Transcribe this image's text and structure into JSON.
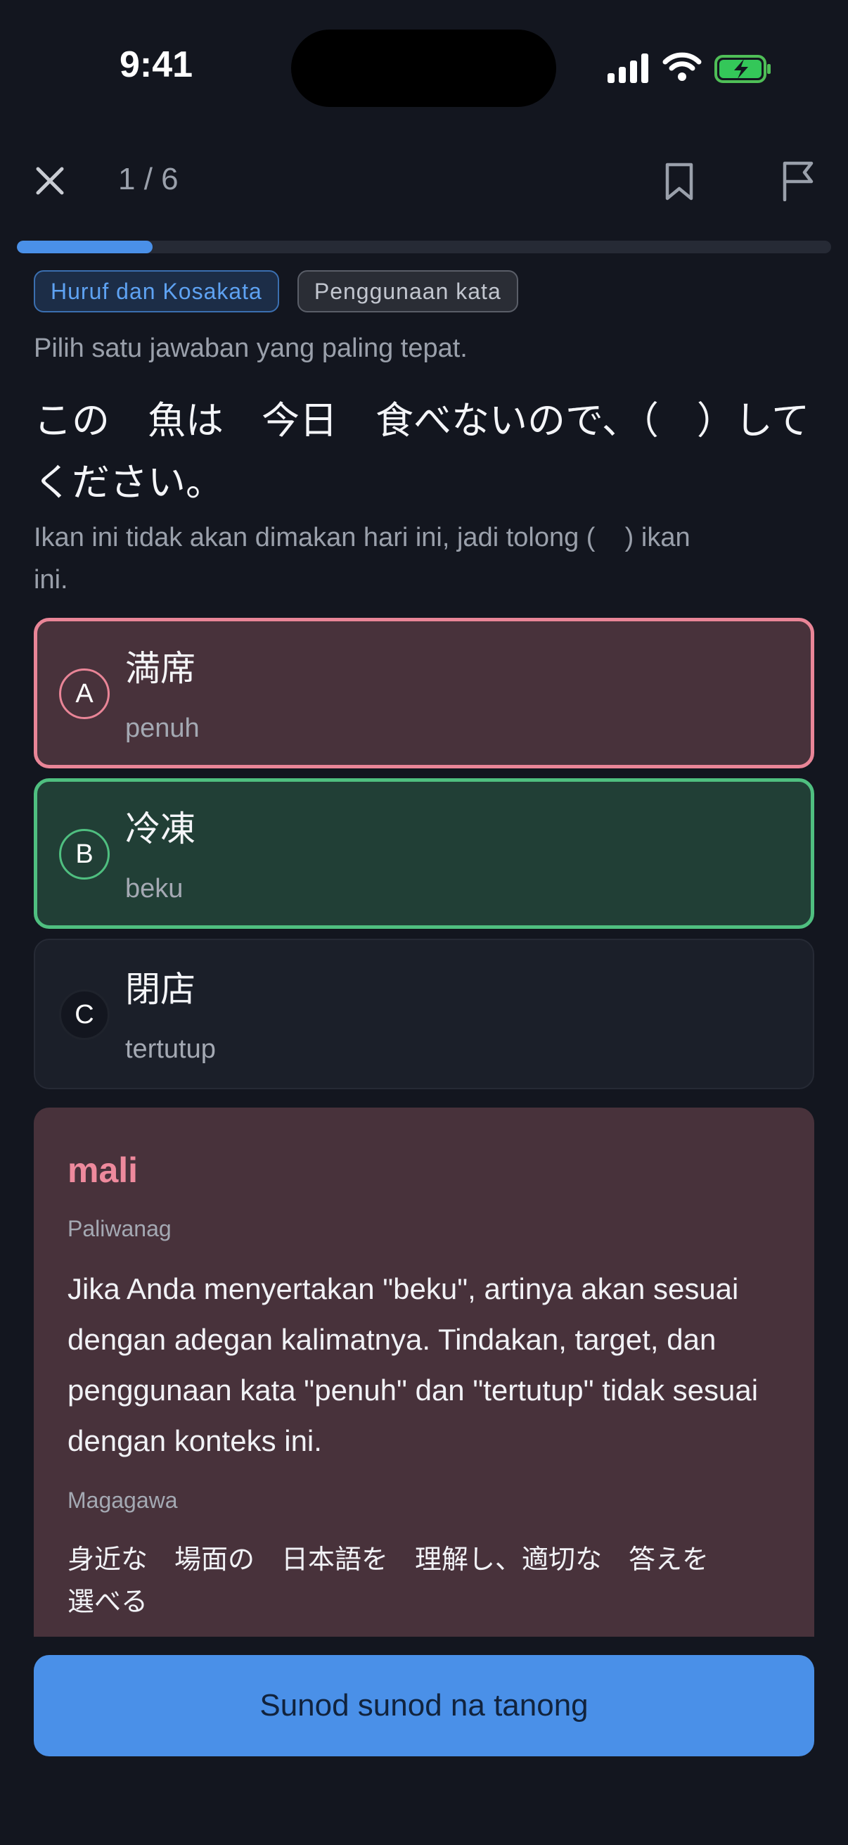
{
  "status_bar": {
    "time": "9:41"
  },
  "header": {
    "counter": "1 / 6",
    "progress_fraction": 0.1667
  },
  "tags": [
    {
      "label": "Huruf dan Kosakata"
    },
    {
      "label": "Penggunaan kata"
    }
  ],
  "question": {
    "instruction": "Pilih satu jawaban yang paling tepat.",
    "japanese": "この　魚は　今日　食べないので、（　）して\nください。",
    "translation": "Ikan ini tidak akan dimakan hari ini, jadi tolong (    ) ikan\nini."
  },
  "options": [
    {
      "letter": "A",
      "word": "満席",
      "meaning": "penuh",
      "state": "incorrect"
    },
    {
      "letter": "B",
      "word": "冷凍",
      "meaning": "beku",
      "state": "correct"
    },
    {
      "letter": "C",
      "word": "閉店",
      "meaning": "tertutup",
      "state": "neutral"
    }
  ],
  "feedback": {
    "result": "mali",
    "explanation_label": "Paliwanag",
    "explanation": "Jika Anda menyertakan \"beku\", artinya akan sesuai dengan adegan kalimatnya. Tindakan, target, dan penggunaan kata \"penuh\" dan \"tertutup\" tidak sesuai dengan konteks ini.",
    "skill_label": "Magagawa",
    "skill": "身近な　場面の　日本語を　理解し、適切な　答えを\n選べる"
  },
  "footer": {
    "next_label": "Sunod sunod na tanong"
  },
  "colors": {
    "background": "#13161f",
    "accent": "#4a90e8",
    "incorrect": "#e98597",
    "correct": "#4fbf80"
  },
  "icons": {
    "close": "close-icon",
    "bookmark": "bookmark-icon",
    "flag": "flag-icon"
  }
}
